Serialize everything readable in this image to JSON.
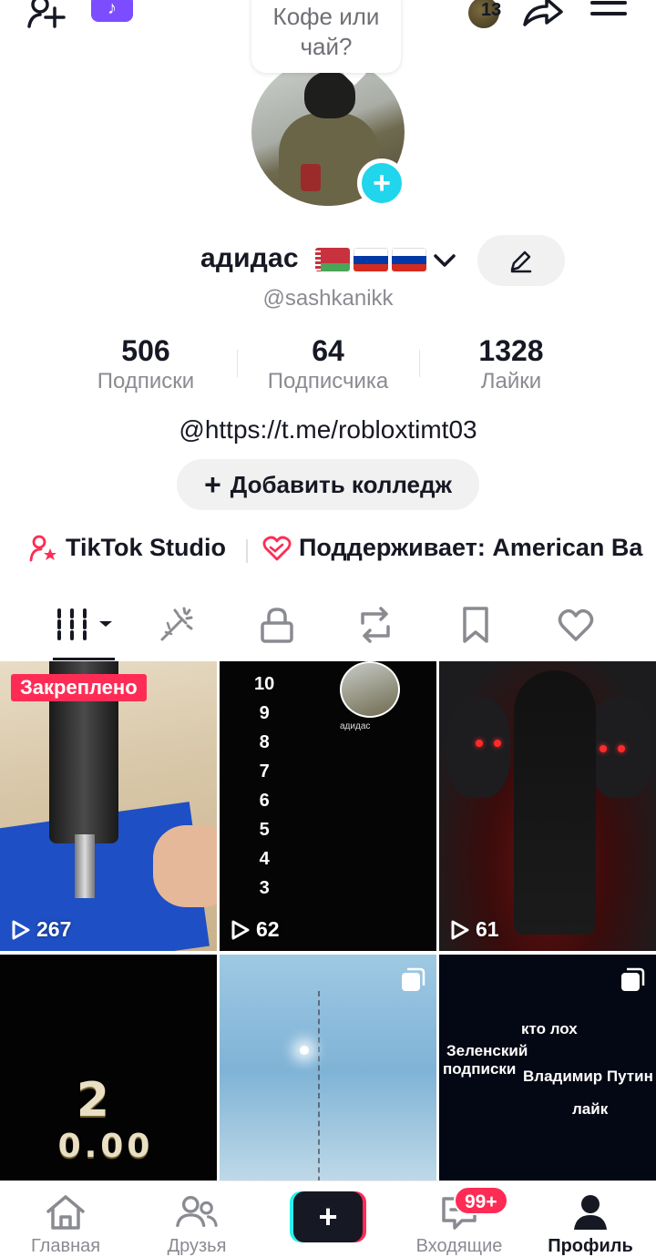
{
  "header": {
    "visitors_count": "13"
  },
  "story_bubble": {
    "line1": "Кофе или",
    "line2": "чай?"
  },
  "profile": {
    "display_name": "адидас",
    "flags": [
      "belarus-flag",
      "russia-flag",
      "russia-flag"
    ],
    "username": "@sashkanikk",
    "bio": "@https://t.me/robloxtimt03",
    "add_college_label": "Добавить колледж"
  },
  "stats": [
    {
      "value": "506",
      "label": "Подписки"
    },
    {
      "value": "64",
      "label": "Подписчика"
    },
    {
      "value": "1328",
      "label": "Лайки"
    }
  ],
  "links": {
    "studio": "TikTok Studio",
    "supports": "Поддерживает: American Ba"
  },
  "tabs": [
    "videos-grid-icon",
    "sparkles-icon",
    "lock-icon",
    "repost-icon",
    "bookmark-icon",
    "heart-icon"
  ],
  "videos": [
    {
      "pinned_label": "Закреплено",
      "views": "267"
    },
    {
      "views": "62",
      "countdown": [
        "10",
        "9",
        "8",
        "7",
        "6",
        "5",
        "4",
        "3"
      ],
      "overlay_name": "адидас"
    },
    {
      "views": "61"
    },
    {
      "score_big": "2",
      "score_small": "0.00"
    },
    {},
    {
      "lines": [
        "кто лох",
        "Зеленский",
        "подписки",
        "Владимир Путин",
        "лайк"
      ]
    }
  ],
  "bottom_nav": {
    "home": "Главная",
    "friends": "Друзья",
    "inbox": "Входящие",
    "inbox_badge": "99+",
    "profile": "Профиль"
  },
  "colors": {
    "accent": "#fe2c55",
    "cyan": "#25f4ee",
    "avatar_plus": "#20d5ec",
    "app_badge": "#7b4dff"
  }
}
